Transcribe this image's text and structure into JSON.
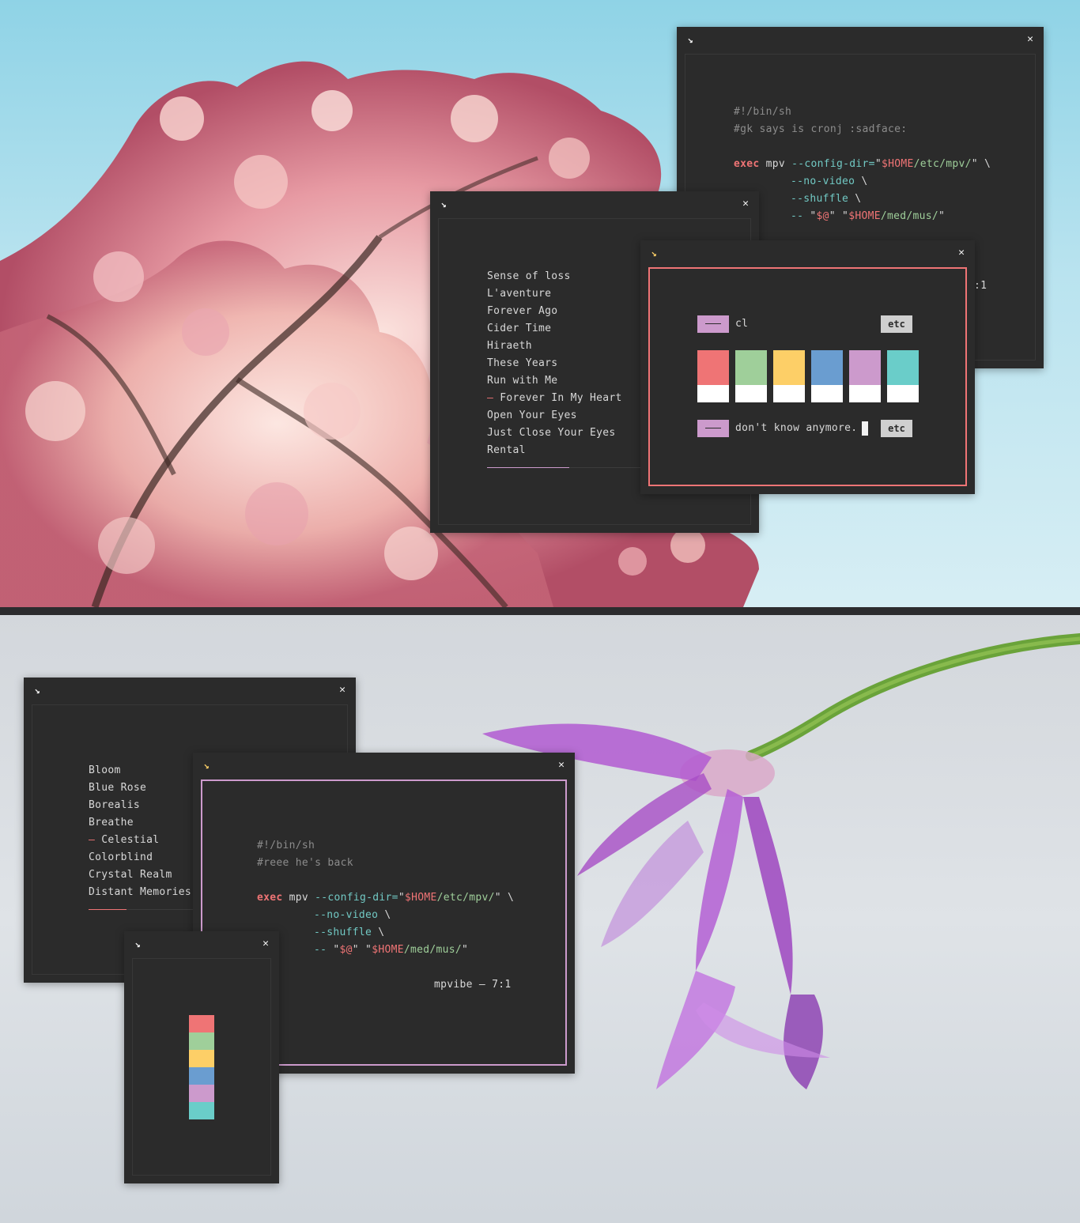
{
  "colors": {
    "red": "#ef7475",
    "green": "#9fcf9a",
    "yellow": "#fdcf67",
    "blue": "#6a9dd0",
    "pink": "#cc9acc",
    "cyan": "#6acdc9",
    "window_bg": "#2b2b2b",
    "text": "#d8d8d8",
    "comment": "#8c8c8c"
  },
  "icons": {
    "maximize": "↘",
    "close": "✕"
  },
  "top": {
    "script_window": {
      "lines": {
        "shebang": "#!/bin/sh",
        "comment": "#gk says is cronj :sadface:",
        "exec_kw": "exec",
        "cmd": " mpv ",
        "config_flag": "--config-dir=",
        "q1": "\"",
        "home1": "$HOME",
        "path1": "/etc/mpv/",
        "q2": "\" \\",
        "no_video": "--no-video",
        "bs1": " \\",
        "shuffle": "--shuffle",
        "bs2": " \\",
        "dashdash": "--",
        "q3": " \"",
        "argsvar": "$@",
        "q4": "\" \"",
        "home2": "$HOME",
        "path2": "/med/mus/",
        "q5": "\"",
        "partial_status": ":1"
      }
    },
    "playlist_window": {
      "items": [
        "Sense of loss",
        "L'aventure",
        "Forever Ago",
        "Cider Time",
        "Hiraeth",
        "These Years",
        "Run with Me",
        "– Forever In My Heart",
        "Open Your Eyes",
        "Just Close Your Eyes",
        "Rental"
      ]
    },
    "palette_window": {
      "row1_label": "cl",
      "row1_badge": "etc",
      "row2_label": "don't know anymore.",
      "row2_badge": "etc",
      "swatches": [
        "red",
        "green",
        "yellow",
        "blue",
        "pink",
        "cyan"
      ]
    }
  },
  "bottom": {
    "playlist_window": {
      "items": [
        "Bloom",
        "Blue Rose",
        "Borealis",
        "Breathe",
        "– Celestial",
        "Colorblind",
        "Crystal Realm",
        "Distant Memories"
      ]
    },
    "script_window": {
      "lines": {
        "shebang": "#!/bin/sh",
        "comment": "#reee he's back",
        "exec_kw": "exec",
        "cmd": " mpv ",
        "config_flag": "--config-dir=",
        "q1": "\"",
        "home1": "$HOME",
        "path1": "/etc/mpv/",
        "q2": "\" \\",
        "no_video": "--no-video",
        "bs1": " \\",
        "shuffle": "--shuffle",
        "bs2": " \\",
        "dashdash": "--",
        "q3": " \"",
        "argsvar": "$@",
        "q4": "\" \"",
        "home2": "$HOME",
        "path2": "/med/mus/",
        "q5": "\"",
        "status": "mpvibe – 7:1"
      }
    },
    "swatch_window": {
      "swatches": [
        "red",
        "green",
        "yellow",
        "blue",
        "pink",
        "cyan"
      ]
    }
  }
}
